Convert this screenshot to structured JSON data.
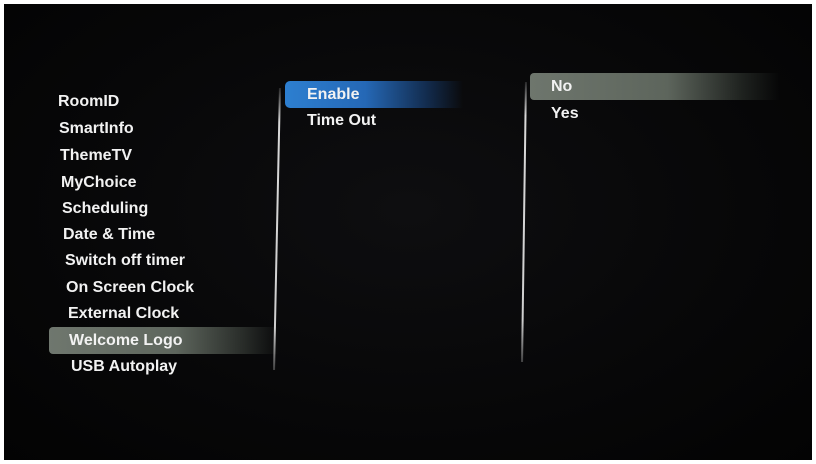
{
  "menu": {
    "level1": {
      "items": [
        {
          "label": "RoomID"
        },
        {
          "label": "SmartInfo"
        },
        {
          "label": "ThemeTV"
        },
        {
          "label": "MyChoice"
        },
        {
          "label": "Scheduling"
        },
        {
          "label": "Date & Time"
        },
        {
          "label": "Switch off timer"
        },
        {
          "label": "On Screen Clock"
        },
        {
          "label": "External Clock"
        },
        {
          "label": "Welcome Logo"
        },
        {
          "label": "USB Autoplay"
        }
      ],
      "selected": "Welcome Logo"
    },
    "level2": {
      "items": [
        {
          "label": "Enable"
        },
        {
          "label": "Time Out"
        }
      ],
      "selected": "Enable"
    },
    "level3": {
      "items": [
        {
          "label": "No"
        },
        {
          "label": "Yes"
        }
      ],
      "selected": "No"
    }
  },
  "colors": {
    "background": "#060607",
    "text": "#f2f2f2",
    "focus_highlight": "#2d7fd0",
    "selection_highlight": "#6f776e"
  }
}
